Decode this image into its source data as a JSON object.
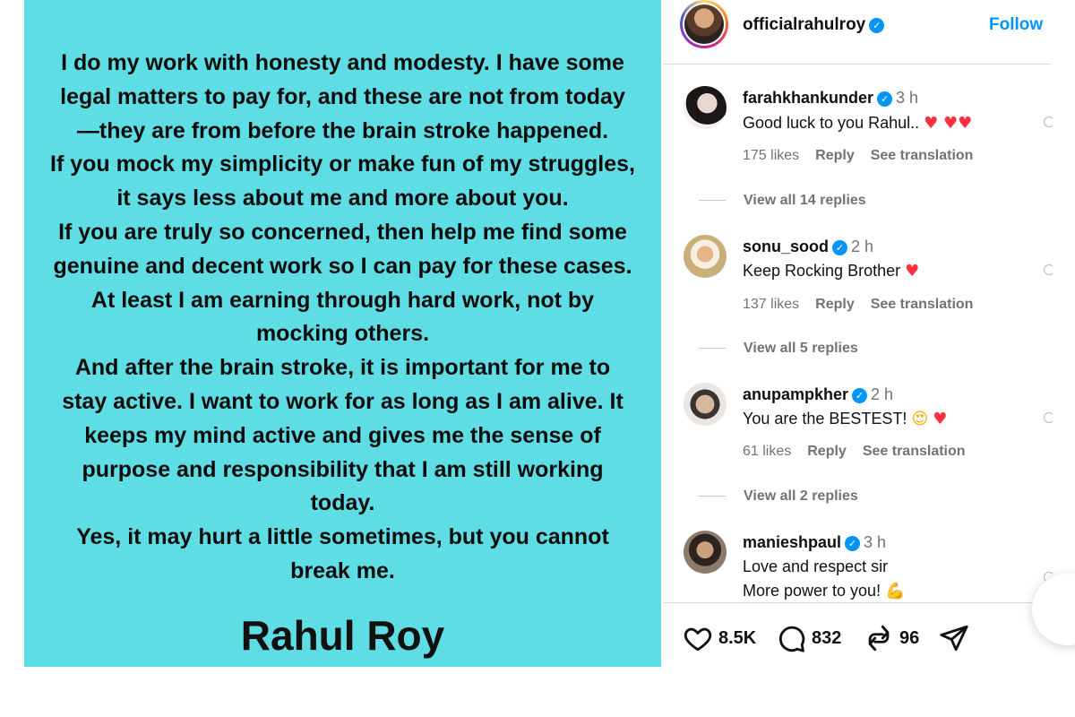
{
  "post": {
    "statement_lines": [
      "I do my work with honesty and modesty. I have some",
      "legal matters to pay for, and these are not from today",
      "—they are from before the brain stroke happened.",
      "If you mock my simplicity or make fun of my struggles,",
      "it says less about me and more about you.",
      "If you are truly so concerned, then help me find some",
      "genuine and decent work so I can pay for these cases.",
      "At least I am earning through hard work, not by",
      "mocking others.",
      "And after the brain stroke, it is important for me to",
      "stay active. I want to work for as long as I am alive. It",
      "keeps my mind active and gives me the sense of",
      "purpose and responsibility that I am still working",
      "today.",
      "Yes, it may hurt a little sometimes, but you cannot",
      "break me."
    ],
    "signature": "Rahul Roy",
    "background_color": "#5fdde5"
  },
  "header": {
    "username": "officialrahulroy",
    "verified_glyph": "✓",
    "follow_label": "Follow"
  },
  "comments": [
    {
      "user": "farahkhankunder",
      "time": "3 h",
      "text": "Good luck to you Rahul..",
      "emoji": "♥ ♥♥",
      "likes": "175 likes",
      "reply": "Reply",
      "translate": "See translation",
      "view_replies": "View all 14 replies"
    },
    {
      "user": "sonu_sood",
      "time": "2 h",
      "text": "Keep Rocking Brother",
      "emoji": "♥",
      "likes": "137 likes",
      "reply": "Reply",
      "translate": "See translation",
      "view_replies": "View all 5 replies"
    },
    {
      "user": "anupampkher",
      "time": "2 h",
      "text": "You are the BESTEST!",
      "emoji_face": "😍",
      "emoji": "♥",
      "likes": "61 likes",
      "reply": "Reply",
      "translate": "See translation",
      "view_replies": "View all 2 replies"
    },
    {
      "user": "manieshpaul",
      "time": "3 h",
      "text": "Love and respect sir",
      "text2": "More power to you!",
      "emoji": "💪"
    }
  ],
  "actions": {
    "likes": "8.5K",
    "comments": "832",
    "reposts": "96"
  },
  "colors": {
    "accent": "#0095f6",
    "heart": "#ff3040",
    "muted": "#737373"
  }
}
